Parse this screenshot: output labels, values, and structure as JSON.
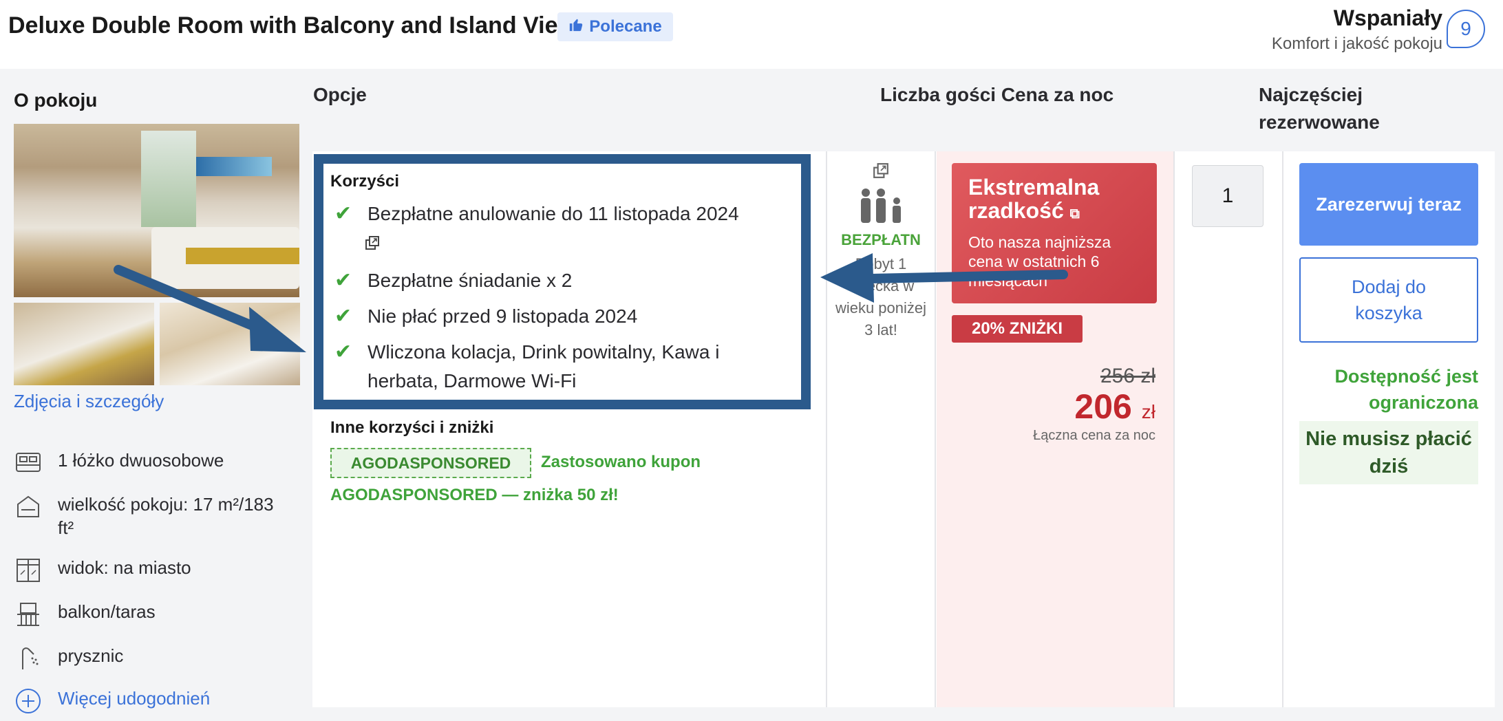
{
  "header": {
    "room_title": "Deluxe Double Room with Balcony and Island View",
    "recommended_label": "Polecane",
    "rating_word": "Wspaniały",
    "rating_sub": "Komfort i jakość pokoju",
    "score": "9"
  },
  "columns": {
    "about": "O pokoju",
    "options": "Opcje",
    "guests_price": "Liczba gości Cena za noc",
    "most_booked_line1": "Najczęściej",
    "most_booked_line2": "rezerwowane"
  },
  "about": {
    "photos_link": "Zdjęcia i szczegóły",
    "amenities": [
      {
        "icon": "bed-icon",
        "label": "1 łóżko dwuosobowe"
      },
      {
        "icon": "room-size-icon",
        "label": "wielkość pokoju: 17 m²/183 ft²"
      },
      {
        "icon": "window-view-icon",
        "label": "widok: na miasto"
      },
      {
        "icon": "balcony-icon",
        "label": "balkon/taras"
      },
      {
        "icon": "shower-icon",
        "label": "prysznic"
      }
    ],
    "more_amenities": "Więcej udogodnień"
  },
  "benefits": {
    "title": "Korzyści",
    "items": [
      "Bezpłatne anulowanie do 11 listopada 2024",
      "Bezpłatne śniadanie x 2",
      "Nie płać przed 9 listopada 2024",
      "Wliczona kolacja, Drink powitalny, Kawa i herbata, Darmowe Wi-Fi"
    ],
    "other_title": "Inne korzyści i zniżki",
    "coupon_code": "AGODASPONSORED",
    "coupon_applied": "Zastosowano kupon",
    "coupon_discount": "AGODASPONSORED — zniżka 50 zł!"
  },
  "guests": {
    "free_label": "BEZPŁATN",
    "note": "Pobyt 1 dziecka w wieku poniżej 3 lat!"
  },
  "price": {
    "rare_title": "Ekstremalna rzadkość",
    "rare_sub": "Oto nasza najniższa cena w ostatnich 6 miesiącach",
    "discount_tag": "20% ZNIŻKI",
    "old_price": "256 zł",
    "new_price": "206",
    "currency": "zł",
    "note": "Łączna cena za noc"
  },
  "quantity": "1",
  "booking": {
    "book_now": "Zarezerwuj teraz",
    "add_to_cart": "Dodaj do koszyka",
    "availability": "Dostępność jest ograniczona",
    "no_pay_today": "Nie musisz płacić dziś"
  },
  "colors": {
    "accent_blue": "#3b72d8",
    "annotation_blue": "#2b5a8c",
    "green": "#3fa33a",
    "price_red": "#c1272d"
  }
}
